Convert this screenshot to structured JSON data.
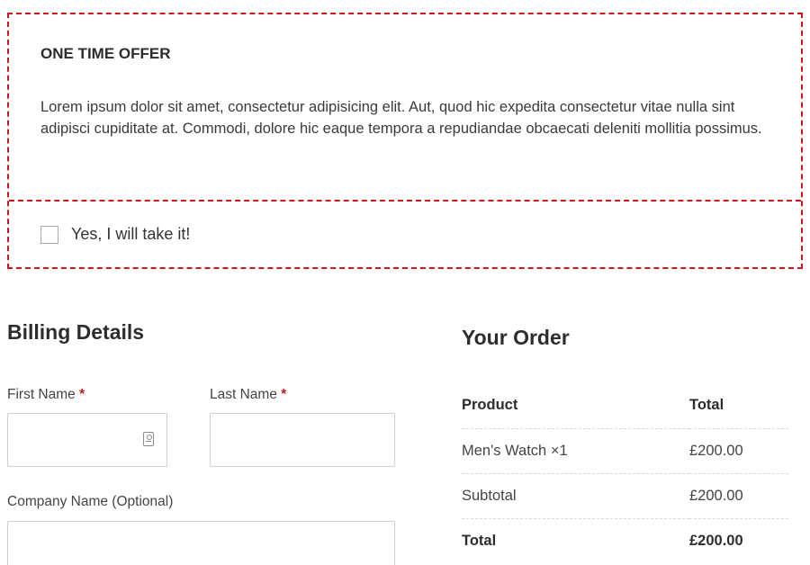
{
  "offer": {
    "title": "ONE TIME OFFER",
    "text": "Lorem ipsum dolor sit amet, consectetur adipisicing elit. Aut, quod hic expedita consectetur vitae nulla sint adipisci cupiditate at. Commodi, dolore hic eaque tempora a repudiandae obcaecati deleniti mollitia possimus.",
    "checkbox_label": "Yes, I will take it!",
    "checked": false,
    "border_color": "#d0151b"
  },
  "billing": {
    "title": "Billing Details",
    "first_name_label": "First Name",
    "last_name_label": "Last Name",
    "required_mark": "*",
    "company_label": "Company Name (Optional)",
    "first_name_value": "",
    "last_name_value": "",
    "company_value": "",
    "contact_icon": "contact-card-icon"
  },
  "order": {
    "title": "Your Order",
    "headers": {
      "product": "Product",
      "total": "Total"
    },
    "rows": [
      {
        "product": "Men's Watch ×1",
        "total": "£200.00"
      },
      {
        "product": "Subtotal",
        "total": "£200.00"
      },
      {
        "product": "Total",
        "total": "£200.00"
      }
    ]
  }
}
